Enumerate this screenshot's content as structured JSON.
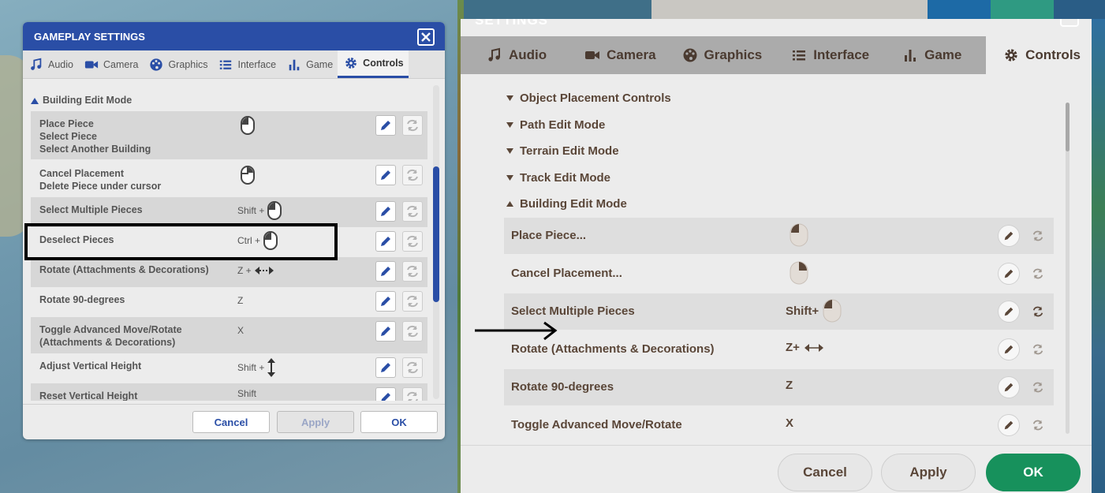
{
  "left_dialog": {
    "title": "GAMEPLAY SETTINGS",
    "close_icon": "x-icon",
    "tabs": [
      {
        "label": "Audio",
        "icon": "music-icon"
      },
      {
        "label": "Camera",
        "icon": "camera-icon"
      },
      {
        "label": "Graphics",
        "icon": "palette-icon"
      },
      {
        "label": "Interface",
        "icon": "list-icon"
      },
      {
        "label": "Game",
        "icon": "bar-chart-icon"
      },
      {
        "label": "Controls",
        "icon": "gear-icon",
        "active": true
      }
    ],
    "section": "Building Edit Mode",
    "rows": [
      {
        "label": "Place Piece\nSelect Piece\nSelect Another Building",
        "modifier": "",
        "input_icon": "mouse-left-icon"
      },
      {
        "label": "Cancel Placement\nDelete Piece under cursor",
        "modifier": "",
        "input_icon": "mouse-right-icon"
      },
      {
        "label": "Select Multiple Pieces",
        "modifier": "Shift +",
        "input_icon": "mouse-left-icon"
      },
      {
        "label": "Deselect Pieces",
        "modifier": "Ctrl +",
        "input_icon": "mouse-left-icon"
      },
      {
        "label": "Rotate (Attachments & Decorations)",
        "modifier": "Z +",
        "input_icon": "horizontal-arrows-icon"
      },
      {
        "label": "Rotate 90-degrees",
        "modifier": "Z",
        "input_icon": ""
      },
      {
        "label": "Toggle Advanced Move/Rotate\n(Attachments & Decorations)",
        "modifier": "X",
        "input_icon": ""
      },
      {
        "label": "Adjust Vertical Height",
        "modifier": "Shift +",
        "input_icon": "vertical-arrows-icon"
      },
      {
        "label": "Reset Vertical Height",
        "modifier": "Shift",
        "input_icon": ""
      }
    ],
    "buttons": {
      "cancel": "Cancel",
      "apply": "Apply",
      "ok": "OK"
    },
    "accent": "#2a4ea6"
  },
  "right_dialog": {
    "title": "SETTINGS",
    "tabs": [
      {
        "label": "Audio",
        "icon": "music-icon"
      },
      {
        "label": "Camera",
        "icon": "camera-icon"
      },
      {
        "label": "Graphics",
        "icon": "palette-icon"
      },
      {
        "label": "Interface",
        "icon": "list-icon"
      },
      {
        "label": "Game",
        "icon": "bar-chart-icon"
      },
      {
        "label": "Controls",
        "icon": "gear-icon",
        "active": true
      }
    ],
    "groups": [
      {
        "label": "Object Placement Controls",
        "expanded": false
      },
      {
        "label": "Path Edit Mode",
        "expanded": false
      },
      {
        "label": "Terrain Edit Mode",
        "expanded": false
      },
      {
        "label": "Track Edit Mode",
        "expanded": false
      },
      {
        "label": "Building Edit Mode",
        "expanded": true
      }
    ],
    "rows": [
      {
        "label": "Place Piece...",
        "modifier": "",
        "input_icon": "mouse-left-icon"
      },
      {
        "label": "Cancel Placement...",
        "modifier": "",
        "input_icon": "mouse-right-icon"
      },
      {
        "label": "Select Multiple Pieces",
        "modifier": "Shift+",
        "input_icon": "mouse-left-icon"
      },
      {
        "label": "Rotate (Attachments & Decorations)",
        "modifier": "Z+",
        "input_icon": "horizontal-arrows-icon"
      },
      {
        "label": "Rotate 90-degrees",
        "modifier": "Z",
        "input_icon": ""
      },
      {
        "label": "Toggle Advanced Move/Rotate",
        "modifier": "X",
        "input_icon": ""
      }
    ],
    "buttons": {
      "cancel": "Cancel",
      "apply": "Apply",
      "ok": "OK"
    },
    "accent": "#17915c"
  }
}
